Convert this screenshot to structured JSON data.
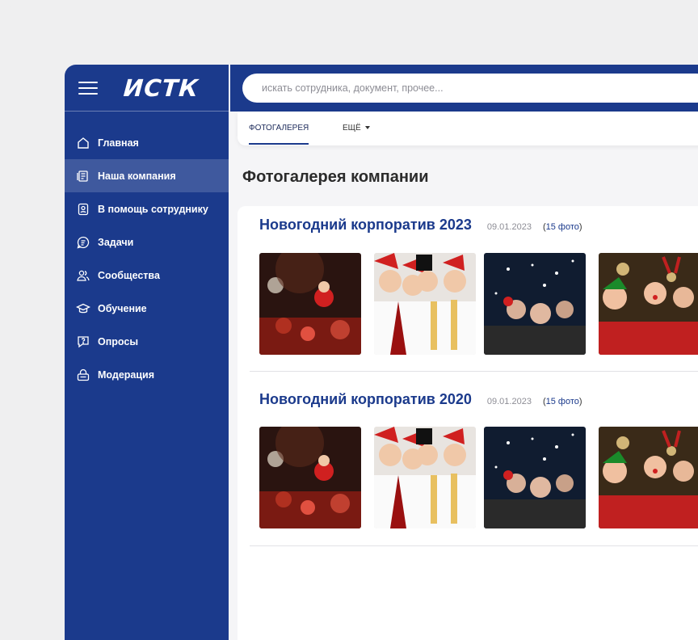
{
  "brand": {
    "logo": "ИСТК"
  },
  "search": {
    "placeholder": "искать сотрудника, документ, прочее..."
  },
  "sidebar": {
    "items": [
      {
        "label": "Главная",
        "icon": "home-icon"
      },
      {
        "label": "Наша компания",
        "icon": "company-icon",
        "active": true
      },
      {
        "label": "В помощь сотруднику",
        "icon": "help-badge-icon"
      },
      {
        "label": "Задачи",
        "icon": "tasks-icon"
      },
      {
        "label": "Сообщества",
        "icon": "community-icon"
      },
      {
        "label": "Обучение",
        "icon": "education-icon"
      },
      {
        "label": "Опросы",
        "icon": "survey-icon"
      },
      {
        "label": "Модерация",
        "icon": "moderation-icon"
      }
    ]
  },
  "tabs": {
    "gallery": "ФОТОГАЛЕРЕЯ",
    "more": "ЕЩЁ"
  },
  "page": {
    "title": "Фотогалерея компании"
  },
  "albums": [
    {
      "title": "Новогодний корпоратив 2023",
      "date": "09.01.2023",
      "count_open": "(",
      "count": "15 фото",
      "count_close": ")"
    },
    {
      "title": "Новогодний корпоратив 2020",
      "date": "09.01.2023",
      "count_open": "(",
      "count": "15 фото",
      "count_close": ")"
    }
  ],
  "colors": {
    "primary": "#1b3a8c",
    "background": "#f5f5f7",
    "accent_red": "#c62828"
  }
}
